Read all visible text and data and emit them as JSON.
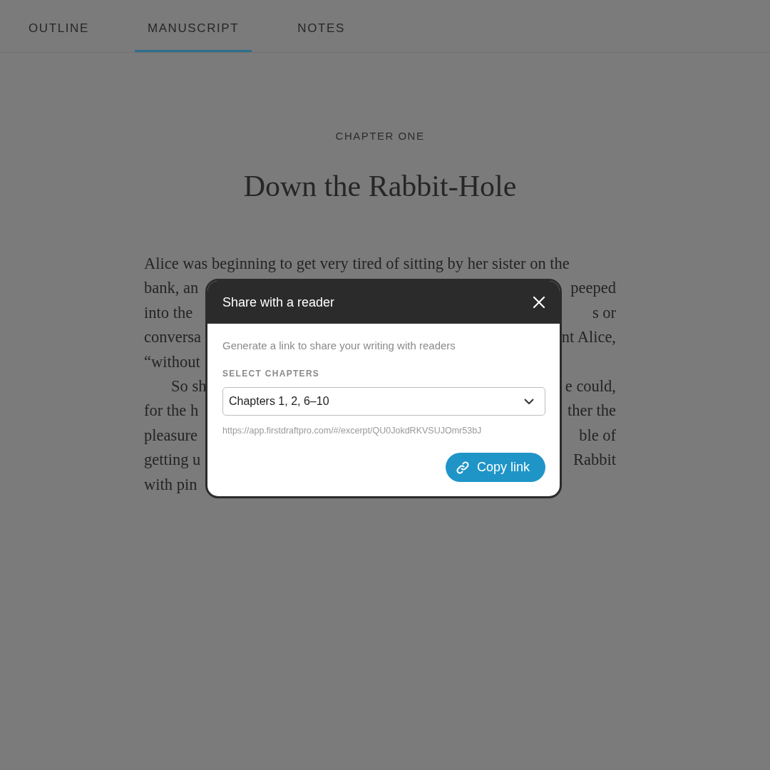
{
  "tabs": [
    {
      "label": "OUTLINE",
      "selected": false
    },
    {
      "label": "MANUSCRIPT",
      "selected": true
    },
    {
      "label": "NOTES",
      "selected": false
    }
  ],
  "chapter": {
    "label": "CHAPTER ONE",
    "title": "Down the Rabbit-Hole"
  },
  "text_lines": [
    {
      "left": "Alice was beginning to get very tired of sitting by her sister on the",
      "indent": false
    },
    {
      "left": "bank, an",
      "right": "peeped",
      "indent": false
    },
    {
      "left": "into the",
      "right": "s or",
      "indent": false
    },
    {
      "left": "conversa",
      "right": "nt Alice,",
      "indent": false
    },
    {
      "left": "“without",
      "indent": false
    },
    {
      "left": "So sh",
      "right": "e could,",
      "indent": true
    },
    {
      "left": "for the h",
      "right": "ther the",
      "indent": false
    },
    {
      "left": "pleasure",
      "right": "ble of",
      "indent": false
    },
    {
      "left": "getting u",
      "right": "Rabbit",
      "indent": false
    },
    {
      "left": "with pin",
      "indent": false
    }
  ],
  "dialog": {
    "title": "Share with a reader",
    "description": "Generate a link to share your writing with readers",
    "field_label": "SELECT CHAPTERS",
    "select": {
      "value": "Chapters 1, 2, 6–10"
    },
    "link": "https://app.firstdraftpro.com/#/excerpt/QU0JokdRKVSUJOmr53bJ",
    "button": "Copy link"
  }
}
